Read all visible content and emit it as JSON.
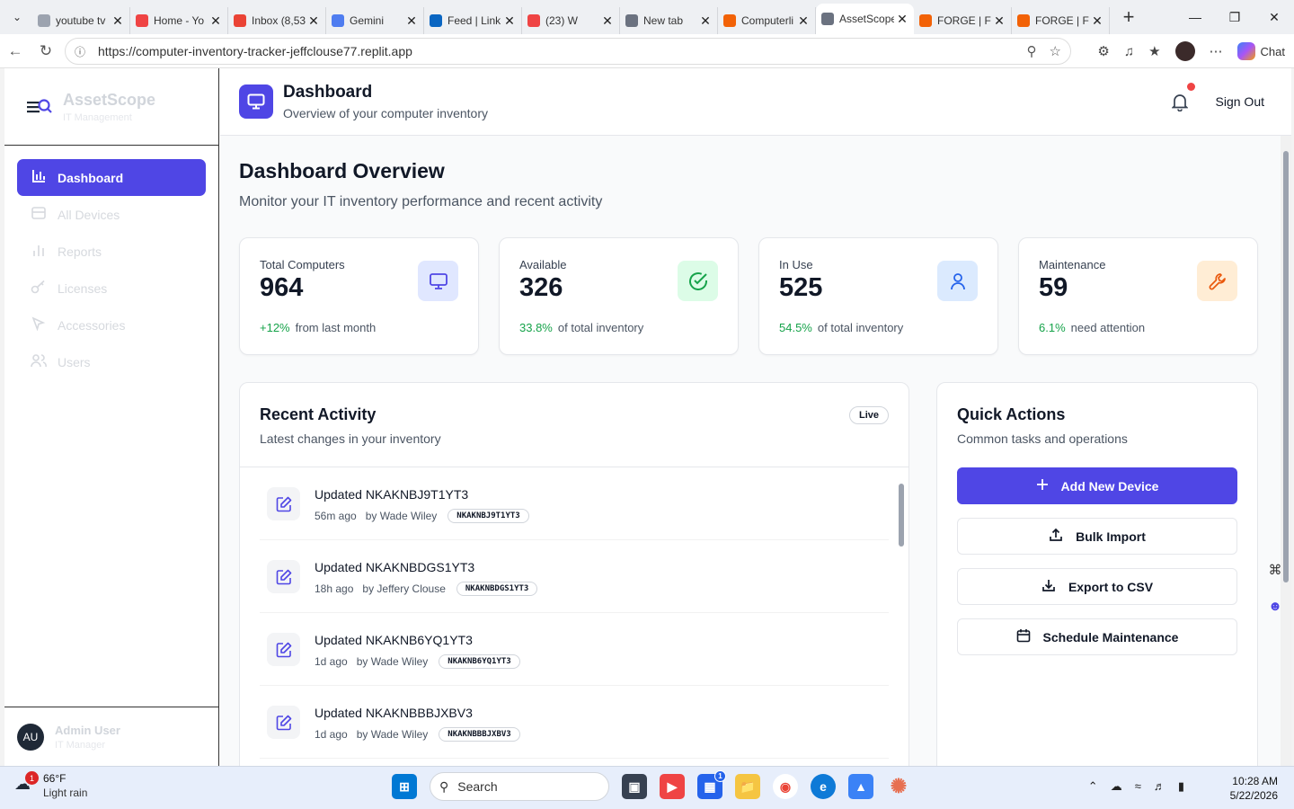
{
  "browser": {
    "tabs": [
      {
        "title": "youtube tv",
        "color": "#9ca3af",
        "icon": "search-icon"
      },
      {
        "title": "Home - Yo",
        "color": "#ef4444",
        "icon": "youtube-icon"
      },
      {
        "title": "Inbox (8,53",
        "color": "#ea4335",
        "icon": "gmail-icon"
      },
      {
        "title": "Gemini",
        "color": "#4f7df0",
        "icon": "gemini-icon"
      },
      {
        "title": "Feed | Link",
        "color": "#0a66c2",
        "icon": "linkedin-icon"
      },
      {
        "title": "(23) W",
        "color": "#ef4444",
        "icon": "youtube-icon"
      },
      {
        "title": "New tab",
        "color": "#6b7280",
        "icon": "newtab-icon"
      },
      {
        "title": "Computerli",
        "color": "#f26207",
        "icon": "replit-icon"
      },
      {
        "title": "AssetScope",
        "color": "#6b7280",
        "icon": "globe-icon",
        "active": true
      },
      {
        "title": "FORGE | Fli",
        "color": "#f26207",
        "icon": "replit-icon"
      },
      {
        "title": "FORGE | Fli",
        "color": "#f26207",
        "icon": "replit-icon"
      }
    ],
    "url": "https://computer-inventory-tracker-jeffclouse77.replit.app",
    "chat_label": "Chat"
  },
  "sidebar": {
    "brand_name": "AssetScope",
    "brand_sub": "IT Management",
    "items": [
      {
        "label": "Dashboard",
        "icon": "bar-chart-icon",
        "active": true
      },
      {
        "label": "All Devices",
        "icon": "devices-icon"
      },
      {
        "label": "Reports",
        "icon": "reports-icon"
      },
      {
        "label": "Licenses",
        "icon": "key-icon"
      },
      {
        "label": "Accessories",
        "icon": "mouse-pointer-icon"
      },
      {
        "label": "Users",
        "icon": "users-icon"
      }
    ],
    "user": {
      "initials": "AU",
      "name": "Admin User",
      "role": "IT Manager"
    }
  },
  "header": {
    "title": "Dashboard",
    "subtitle": "Overview of your computer inventory",
    "sign_out": "Sign Out"
  },
  "overview": {
    "title": "Dashboard Overview",
    "subtitle": "Monitor your IT inventory performance and recent activity"
  },
  "stats": [
    {
      "label": "Total Computers",
      "value": "964",
      "pct": "+12%",
      "foot": "from last month",
      "icon": "monitor-icon",
      "icon_bg": "#e0e7ff",
      "icon_color": "#4f46e5"
    },
    {
      "label": "Available",
      "value": "326",
      "pct": "33.8%",
      "foot": "of total inventory",
      "icon": "check-circle-icon",
      "icon_bg": "#dcfce7",
      "icon_color": "#16a34a"
    },
    {
      "label": "In Use",
      "value": "525",
      "pct": "54.5%",
      "foot": "of total inventory",
      "icon": "user-icon",
      "icon_bg": "#dbeafe",
      "icon_color": "#2563eb"
    },
    {
      "label": "Maintenance",
      "value": "59",
      "pct": "6.1%",
      "foot": "need attention",
      "icon": "wrench-icon",
      "icon_bg": "#ffedd5",
      "icon_color": "#ea580c"
    }
  ],
  "recent": {
    "title": "Recent Activity",
    "subtitle": "Latest changes in your inventory",
    "badge": "Live",
    "items": [
      {
        "title": "Updated NKAKNBJ9T1YT3",
        "time": "56m ago",
        "by": "by Wade Wiley",
        "tag": "NKAKNBJ9T1YT3"
      },
      {
        "title": "Updated NKAKNBDGS1YT3",
        "time": "18h ago",
        "by": "by Jeffery Clouse",
        "tag": "NKAKNBDGS1YT3"
      },
      {
        "title": "Updated NKAKNB6YQ1YT3",
        "time": "1d ago",
        "by": "by Wade Wiley",
        "tag": "NKAKNB6YQ1YT3"
      },
      {
        "title": "Updated NKAKNBBBJXBV3",
        "time": "1d ago",
        "by": "by Wade Wiley",
        "tag": "NKAKNBBBJXBV3"
      }
    ]
  },
  "quick": {
    "title": "Quick Actions",
    "subtitle": "Common tasks and operations",
    "buttons": [
      {
        "label": "Add New Device",
        "icon": "plus-icon"
      },
      {
        "label": "Bulk Import",
        "icon": "upload-icon"
      },
      {
        "label": "Export to CSV",
        "icon": "download-icon"
      },
      {
        "label": "Schedule Maintenance",
        "icon": "calendar-icon"
      }
    ]
  },
  "taskbar": {
    "weather_temp": "66°F",
    "weather_cond": "Light rain",
    "weather_badge": "1",
    "search_placeholder": "Search",
    "store_badge": "1",
    "time": "10:28 AM",
    "date": "5/22/2026"
  }
}
